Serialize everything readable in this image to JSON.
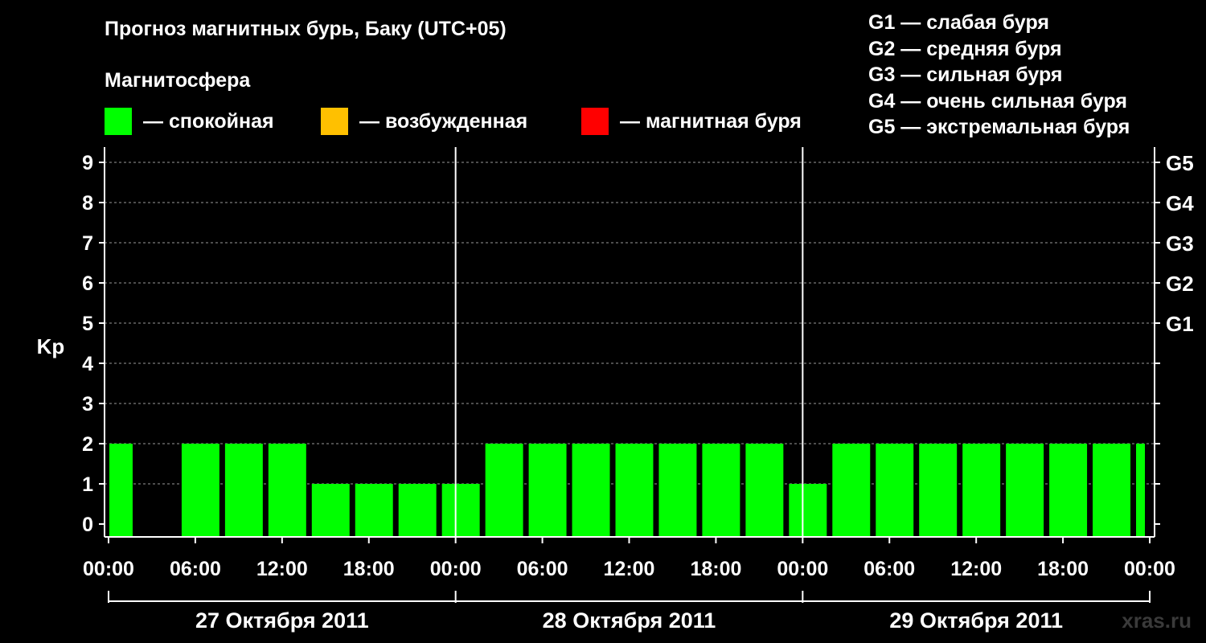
{
  "header": {
    "title": "Прогноз магнитных бурь, Баку (UTC+05)",
    "subtitle": "Магнитосфера"
  },
  "legend": {
    "items": [
      {
        "label": "— спокойная",
        "color": "#00ff00"
      },
      {
        "label": "— возбужденная",
        "color": "#ffc000"
      },
      {
        "label": "— магнитная буря",
        "color": "#ff0000"
      }
    ]
  },
  "g_legend": [
    "G1 — слабая буря",
    "G2 — средняя буря",
    "G3 — сильная буря",
    "G4 — очень сильная буря",
    "G5 — экстремальная буря"
  ],
  "watermark": "xras.ru",
  "chart_data": {
    "type": "bar",
    "ylabel": "Kp",
    "ylim": [
      0,
      9
    ],
    "y_ticks": [
      "0",
      "1",
      "2",
      "3",
      "4",
      "5",
      "6",
      "7",
      "8",
      "9"
    ],
    "right_ticks": [
      {
        "value": 5,
        "label": "G1"
      },
      {
        "value": 6,
        "label": "G2"
      },
      {
        "value": 7,
        "label": "G3"
      },
      {
        "value": 8,
        "label": "G4"
      },
      {
        "value": 9,
        "label": "G5"
      }
    ],
    "x_tick_labels": [
      "00:00",
      "06:00",
      "12:00",
      "18:00",
      "00:00",
      "06:00",
      "12:00",
      "18:00",
      "00:00",
      "06:00",
      "12:00",
      "18:00",
      "00:00"
    ],
    "days": [
      "27 Октября 2011",
      "28 Октября 2011",
      "29 Октября 2011"
    ],
    "grid": true,
    "bar_color": "#00ff00",
    "bars": [
      {
        "start": "27 Октября 2011 00:00",
        "end": "27 Октября 2011 02:00",
        "kp": 2
      },
      {
        "start": "27 Октября 2011 02:00",
        "end": "27 Октября 2011 05:00",
        "kp": 0
      },
      {
        "start": "27 Октября 2011 05:00",
        "end": "27 Октября 2011 08:00",
        "kp": 2
      },
      {
        "start": "27 Октября 2011 08:00",
        "end": "27 Октября 2011 11:00",
        "kp": 2
      },
      {
        "start": "27 Октября 2011 11:00",
        "end": "27 Октября 2011 14:00",
        "kp": 2
      },
      {
        "start": "27 Октября 2011 14:00",
        "end": "27 Октября 2011 17:00",
        "kp": 1
      },
      {
        "start": "27 Октября 2011 17:00",
        "end": "27 Октября 2011 20:00",
        "kp": 1
      },
      {
        "start": "27 Октября 2011 20:00",
        "end": "27 Октября 2011 23:00",
        "kp": 1
      },
      {
        "start": "27 Октября 2011 23:00",
        "end": "28 Октября 2011 02:00",
        "kp": 1
      },
      {
        "start": "28 Октября 2011 02:00",
        "end": "28 Октября 2011 05:00",
        "kp": 2
      },
      {
        "start": "28 Октября 2011 05:00",
        "end": "28 Октября 2011 08:00",
        "kp": 2
      },
      {
        "start": "28 Октября 2011 08:00",
        "end": "28 Октября 2011 11:00",
        "kp": 2
      },
      {
        "start": "28 Октября 2011 11:00",
        "end": "28 Октября 2011 14:00",
        "kp": 2
      },
      {
        "start": "28 Октября 2011 14:00",
        "end": "28 Октября 2011 17:00",
        "kp": 2
      },
      {
        "start": "28 Октября 2011 17:00",
        "end": "28 Октября 2011 20:00",
        "kp": 2
      },
      {
        "start": "28 Октября 2011 20:00",
        "end": "28 Октября 2011 23:00",
        "kp": 2
      },
      {
        "start": "28 Октября 2011 23:00",
        "end": "29 Октября 2011 02:00",
        "kp": 1
      },
      {
        "start": "29 Октября 2011 02:00",
        "end": "29 Октября 2011 05:00",
        "kp": 2
      },
      {
        "start": "29 Октября 2011 05:00",
        "end": "29 Октября 2011 08:00",
        "kp": 2
      },
      {
        "start": "29 Октября 2011 08:00",
        "end": "29 Октября 2011 11:00",
        "kp": 2
      },
      {
        "start": "29 Октября 2011 11:00",
        "end": "29 Октября 2011 14:00",
        "kp": 2
      },
      {
        "start": "29 Октября 2011 14:00",
        "end": "29 Октября 2011 17:00",
        "kp": 2
      },
      {
        "start": "29 Октября 2011 17:00",
        "end": "29 Октября 2011 20:00",
        "kp": 2
      },
      {
        "start": "29 Октября 2011 20:00",
        "end": "29 Октября 2011 23:00",
        "kp": 2
      },
      {
        "start": "29 Октября 2011 23:00",
        "end": "30 Октября 2011 00:00",
        "kp": 2
      }
    ]
  }
}
